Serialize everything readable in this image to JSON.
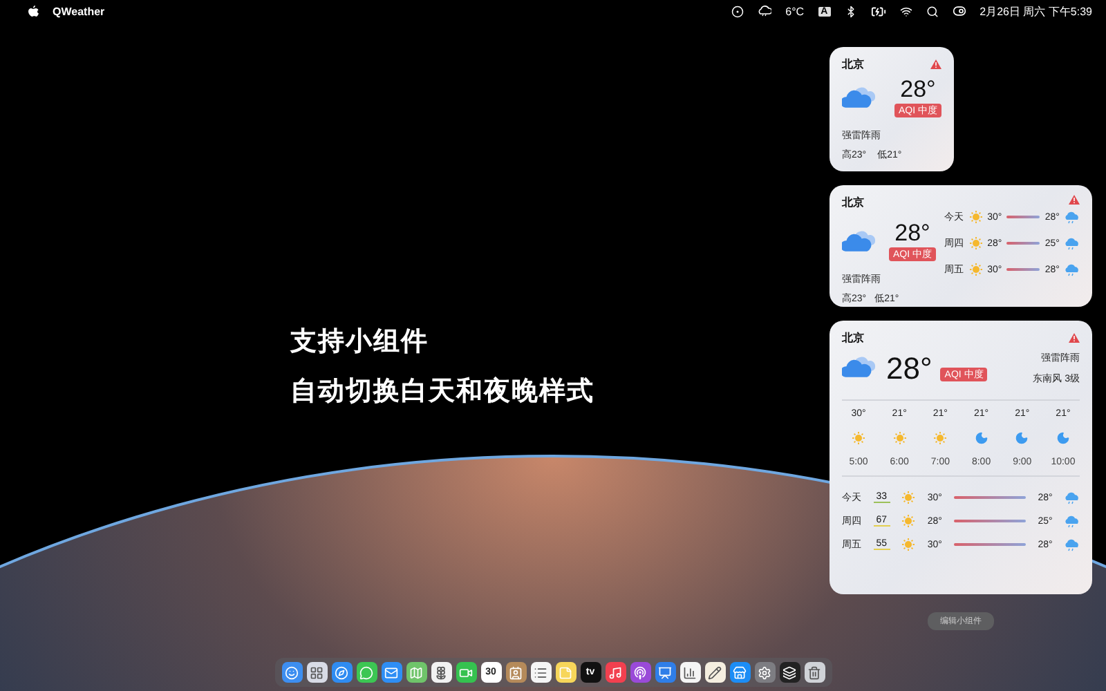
{
  "menu_bar": {
    "app_name": "QWeather",
    "temperature": "6°C",
    "input_method": "A",
    "date_time": "2月26日 周六 下午5:39"
  },
  "headline": [
    "支持小组件",
    "自动切换白天和夜晚样式"
  ],
  "small_widget": {
    "city": "北京",
    "temperature": "28°",
    "aqi": "AQI 中度",
    "condition": "强雷阵雨",
    "high": "高23°",
    "low": "低21°"
  },
  "medium_widget": {
    "city": "北京",
    "temperature": "28°",
    "aqi": "AQI 中度",
    "condition": "强雷阵雨",
    "high": "高23°",
    "low": "低21°",
    "forecast": [
      {
        "day": "今天",
        "high": "30°",
        "low": "28°"
      },
      {
        "day": "周四",
        "high": "28°",
        "low": "25°"
      },
      {
        "day": "周五",
        "high": "30°",
        "low": "28°"
      }
    ]
  },
  "large_widget": {
    "city": "北京",
    "temperature": "28°",
    "aqi": "AQI 中度",
    "condition": "强雷阵雨",
    "wind": "东南风 3级",
    "hourly": [
      {
        "temp": "30°",
        "kind": "sun",
        "time": "5:00"
      },
      {
        "temp": "21°",
        "kind": "sun",
        "time": "6:00"
      },
      {
        "temp": "21°",
        "kind": "sun",
        "time": "7:00"
      },
      {
        "temp": "21°",
        "kind": "moon",
        "time": "8:00"
      },
      {
        "temp": "21°",
        "kind": "moon",
        "time": "9:00"
      },
      {
        "temp": "21°",
        "kind": "moon",
        "time": "10:00"
      }
    ],
    "daily": [
      {
        "day": "今天",
        "aqi": "33",
        "color": "#9cc05a",
        "high": "30°",
        "low": "28°"
      },
      {
        "day": "周四",
        "aqi": "67",
        "color": "#e3cf4f",
        "high": "28°",
        "low": "25°"
      },
      {
        "day": "周五",
        "aqi": "55",
        "color": "#e3cf4f",
        "high": "30°",
        "low": "28°"
      }
    ]
  },
  "edit_button": "编辑小组件",
  "dock": [
    {
      "kind": "face",
      "color": "#3d8ef0"
    },
    {
      "kind": "grid",
      "color": "#d8dbe6"
    },
    {
      "kind": "compass",
      "color": "#2f8cf2"
    },
    {
      "kind": "chat",
      "color": "#3cc653"
    },
    {
      "kind": "mail",
      "color": "#2e8ef5"
    },
    {
      "kind": "map",
      "color": "#6fc46a"
    },
    {
      "kind": "flower",
      "color": "#f2f2f2"
    },
    {
      "kind": "video",
      "color": "#35c24f"
    },
    {
      "kind": "calendar",
      "color": "#ffffff",
      "label": "30"
    },
    {
      "kind": "contact",
      "color": "#b58a5a"
    },
    {
      "kind": "list",
      "color": "#f5f5f5"
    },
    {
      "kind": "note",
      "color": "#f7d65a"
    },
    {
      "kind": "tv",
      "color": "#111111",
      "label": "tv"
    },
    {
      "kind": "music",
      "color": "#f2404f"
    },
    {
      "kind": "podcast",
      "color": "#9a4ad8"
    },
    {
      "kind": "presentation",
      "color": "#2f7ee8"
    },
    {
      "kind": "chart",
      "color": "#f5f5f5"
    },
    {
      "kind": "pencil",
      "color": "#f5efe0"
    },
    {
      "kind": "store",
      "color": "#1c8df5"
    },
    {
      "kind": "gear",
      "color": "#7d7d82"
    },
    {
      "kind": "stack",
      "color": "#222222"
    },
    {
      "kind": "trash",
      "color": "#d0d3d8"
    }
  ]
}
